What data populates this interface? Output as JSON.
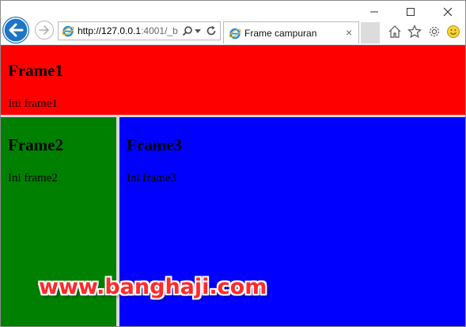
{
  "browser": {
    "address_host": "http://127.0.0.1",
    "address_rest": ":4001/_b",
    "tab_title": "Frame campuran",
    "tab_close": "×",
    "accent_color": "#1e74c5"
  },
  "frames": [
    {
      "heading": "Frame1",
      "text": "Ini frame1",
      "color": "#ff0000"
    },
    {
      "heading": "Frame2",
      "text": "Ini frame2",
      "color": "#008000"
    },
    {
      "heading": "Frame3",
      "text": "Ini frame3",
      "color": "#0000ff"
    }
  ],
  "watermark": "www.banghaji.com"
}
